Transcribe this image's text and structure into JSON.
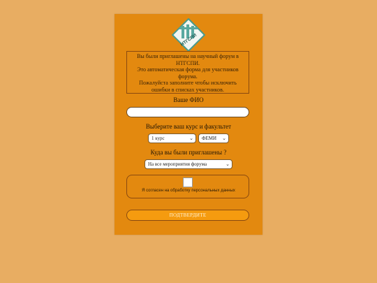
{
  "logo": {
    "text": "НТГСПИ",
    "icon": "university-logo-icon",
    "colors": {
      "border": "#4a9a8c",
      "fill": "#f2f6f2",
      "accent": "#5aa9a0",
      "text": "#1d5a55"
    }
  },
  "notice": {
    "line1": "Вы были приглашены на научный форум в НТГСПИ.",
    "line2": "Это автоматическая форма для участников форума.",
    "line3": "Пожалуйста заполните чтобы исключить ошибки в списках участников."
  },
  "form": {
    "name_label": "Ваше ФИО",
    "name_value": "",
    "course_label": "Выберите ваш курс и факультет",
    "course_selected": "1 курс",
    "faculty_selected": "ФЕМИ",
    "event_label": "Куда вы были приглашены ?",
    "event_selected": "На все мероприятия форума",
    "consent_text": "Я согласен на обработку персональных данных",
    "consent_checked": false,
    "submit_label": "ПОДТВЕРДИТЕ"
  },
  "colors": {
    "page_background": "#e8ad62",
    "card_background": "#e3890f",
    "button_background": "#f59b0f",
    "border": "#8a4a10"
  }
}
